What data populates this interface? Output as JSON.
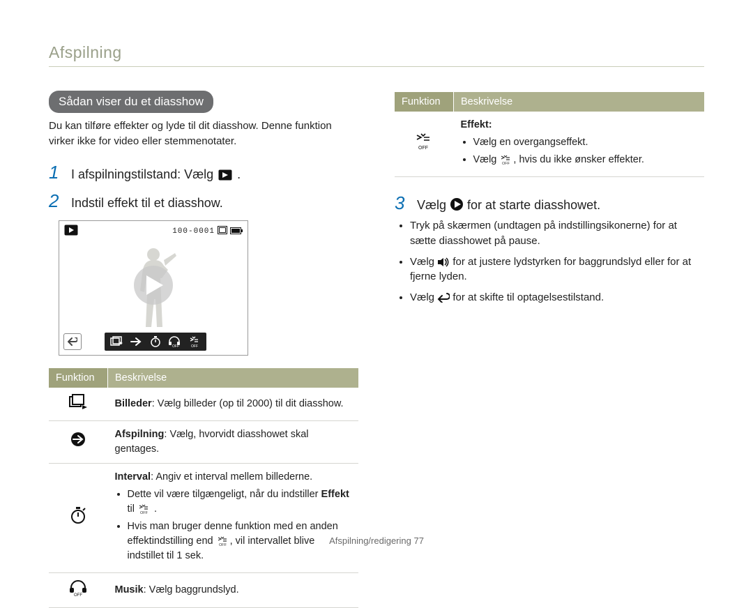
{
  "section_title": "Afspilning",
  "left": {
    "pill": "Sådan viser du et diasshow",
    "lead": "Du kan tilføre effekter og lyde til dit diasshow. Denne funktion virker ikke for video eller stemmenotater.",
    "step1_pre": "I afspilningstilstand: Vælg ",
    "step1_post": ".",
    "step2": "Indstil effekt til et diasshow.",
    "counter": "100-0001",
    "table": {
      "h1": "Funktion",
      "h2": "Beskrivelse",
      "r1": "Billeder: Vælg billeder (op til 2000) til dit diasshow.",
      "r1_b": "Billeder",
      "r2": "Afspilning: Vælg, hvorvidt diasshowet skal gentages.",
      "r2_b": "Afspilning",
      "r3_head": "Interval: Angiv et interval mellem billederne.",
      "r3_head_b": "Interval",
      "r3_b1_pre": "Dette vil være tilgængeligt, når du indstiller ",
      "r3_b1_bold": "Effekt",
      "r3_b1_post_pre": "til ",
      "r3_b1_post_post": " .",
      "r3_b2_pre": "Hvis man bruger denne funktion med en anden effektindstilling end ",
      "r3_b2_post": ", vil intervallet blive indstillet til 1 sek.",
      "r4": "Musik: Vælg baggrundslyd.",
      "r4_b": "Musik"
    }
  },
  "right": {
    "table": {
      "h1": "Funktion",
      "h2": "Beskrivelse",
      "r1_head": "Effekt:",
      "r1_b1": "Vælg en overgangseffekt.",
      "r1_b2_pre": "Vælg ",
      "r1_b2_post": ", hvis du ikke ønsker effekter."
    },
    "step3_pre": "Vælg ",
    "step3_post": " for at starte diasshowet.",
    "b1": "Tryk på skærmen (undtagen på indstillingsikonerne) for at sætte diasshowet på pause.",
    "b2_pre": "Vælg ",
    "b2_post": " for at justere lydstyrken for baggrundslyd eller for at fjerne lyden.",
    "b3_pre": "Vælg ",
    "b3_post": " for at skifte til optagelsestilstand."
  },
  "footer": "Afspilning/redigering  77"
}
